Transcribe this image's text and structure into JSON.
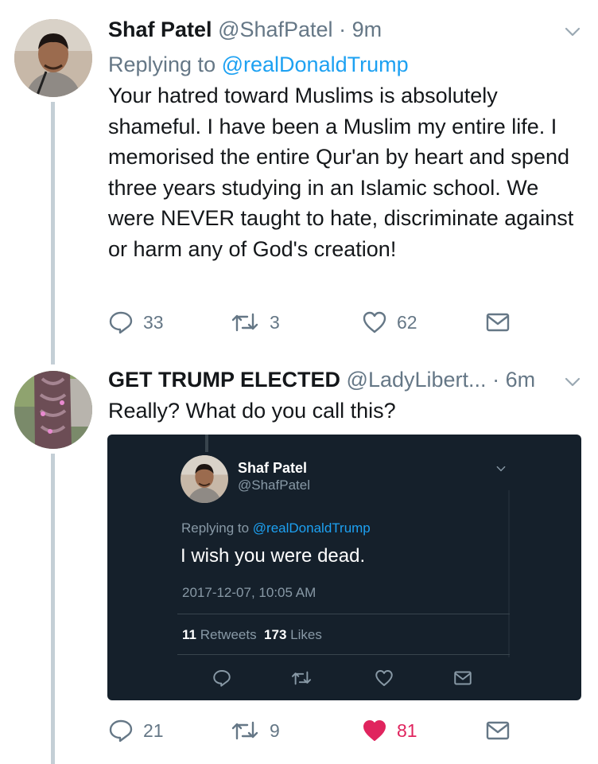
{
  "accent": "#1da1f2",
  "like_active_color": "#e0245e",
  "tweet1": {
    "avatar_icon": "user-avatar",
    "name": "Shaf Patel",
    "handle": "@ShafPatel",
    "separator": "·",
    "time": "9m",
    "replying_prefix": "Replying to",
    "replying_to": "@realDonaldTrump",
    "body": "Your hatred toward Muslims is absolutely shameful. I have been a Muslim my entire life. I memorised the entire Qur'an by heart and spend three years studying in an Islamic school. We were NEVER taught to hate, discriminate against or harm any of God's creation!",
    "replies": "33",
    "retweets": "3",
    "likes": "62"
  },
  "tweet2": {
    "avatar_icon": "user-avatar",
    "name": "GET TRUMP ELECTED",
    "handle": "@LadyLibert...",
    "separator": "·",
    "time": "6m",
    "body": "Really? What do you call this?",
    "replies": "21",
    "retweets": "9",
    "likes": "81",
    "liked": true
  },
  "embedded": {
    "name": "Shaf Patel",
    "handle": "@ShafPatel",
    "replying_prefix": "Replying to",
    "replying_to": "@realDonaldTrump",
    "body": "I wish you were dead.",
    "date": "2017-12-07, 10:05 AM",
    "retweets_count": "11",
    "retweets_label": "Retweets",
    "likes_count": "173",
    "likes_label": "Likes"
  }
}
